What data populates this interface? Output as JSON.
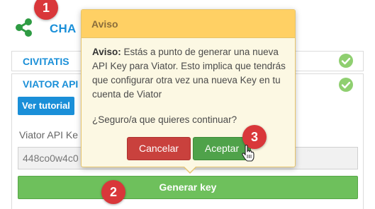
{
  "header": {
    "title": "CHA"
  },
  "panels": [
    {
      "title": "CIVITATIS"
    },
    {
      "title": "VIATOR API"
    }
  ],
  "viator": {
    "tutorial_button": "Ver tutorial",
    "key_label": "Viator API Ke",
    "key_value": "448co0w4c0",
    "generate_button": "Generar key"
  },
  "dialog": {
    "title": "Aviso",
    "body_bold": "Aviso:",
    "body_text": " Estás a punto de generar una nueva API Key para Viator. Esto implica que tendrás que configurar otra vez una nueva Key en tu cuenta de Viator",
    "question": "¿Seguro/a que quieres continuar?",
    "cancel_label": "Cancelar",
    "accept_label": "Aceptar"
  },
  "markers": [
    "1",
    "2",
    "3"
  ],
  "colors": {
    "accent_blue": "#1a8fd8",
    "success_green": "#6ec05c",
    "danger_red": "#c9413d",
    "warning_header": "#ffd064",
    "marker_red": "#d9373a"
  }
}
